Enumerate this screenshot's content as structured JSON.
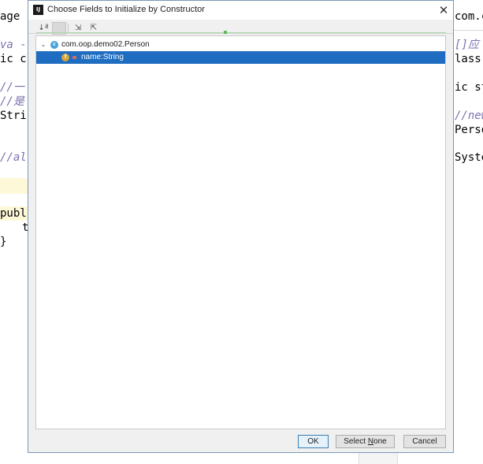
{
  "editor": {
    "left_lines": [
      {
        "text": "age c",
        "style": "header"
      },
      {
        "text": "va --",
        "style": "comment"
      },
      {
        "text": "ic cl",
        "style": "code"
      },
      {
        "text": "//一",
        "style": "comment"
      },
      {
        "text": "//是",
        "style": "comment"
      },
      {
        "text": "Strin",
        "style": "code"
      },
      {
        "text": "//alt",
        "style": "comment"
      },
      {
        "text": "publi",
        "style": "code"
      },
      {
        "text": "t",
        "style": "code"
      },
      {
        "text": "}",
        "style": "code"
      }
    ],
    "right_lines": [
      {
        "text": "com.c",
        "style": "header"
      },
      {
        "text": "[]应",
        "style": "comment"
      },
      {
        "text": "lass",
        "style": "code"
      },
      {
        "text": "ic st",
        "style": "code"
      },
      {
        "text": "//new",
        "style": "comment"
      },
      {
        "text": "Perso",
        "style": "code"
      },
      {
        "text": "Syste",
        "style": "code"
      }
    ]
  },
  "dialog": {
    "title": "Choose Fields to Initialize by Constructor",
    "app_icon_text": "IJ",
    "close_glyph": "✕",
    "toolbar": [
      {
        "name": "sort-alphabetically-icon",
        "glyph": "↓ª",
        "pressed": false
      },
      {
        "name": "show-classes-icon",
        "glyph": "",
        "pressed": true
      },
      {
        "name": "expand-all-icon",
        "glyph": "⇲",
        "pressed": false
      },
      {
        "name": "collapse-all-icon",
        "glyph": "⇱",
        "pressed": false
      }
    ],
    "tree": {
      "class_node": {
        "label": "com.oop.demo02.Person",
        "icon_letter": "c",
        "chevron": "⌄"
      },
      "fields": [
        {
          "label": "name:String",
          "icon_letter": "f",
          "selected": true
        }
      ]
    },
    "buttons": {
      "ok": "OK",
      "select_none_prefix": "Select ",
      "select_none_mnemonic": "N",
      "select_none_suffix": "one",
      "cancel": "Cancel"
    }
  },
  "colors": {
    "selection": "#1e6dc1",
    "dialog_border": "#7a98b8",
    "comment": "#7a6fb0"
  }
}
